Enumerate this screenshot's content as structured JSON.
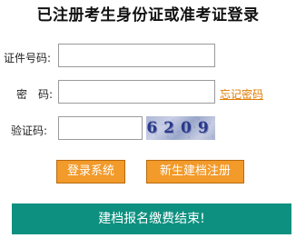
{
  "page": {
    "title": "已注册考生身份证或准考证登录"
  },
  "form": {
    "id_label": "证件号码:",
    "id_value": "",
    "password_label": "密　码:",
    "password_value": "",
    "forgot_link": "忘记密码",
    "captcha_label": "验证码:",
    "captcha_value": "",
    "captcha_code": "6209"
  },
  "buttons": {
    "login": "登录系统",
    "register": "新生建档注册"
  },
  "banner": {
    "text": "建档报名缴费结束!"
  },
  "colors": {
    "button_bg": "#f29a2a",
    "banner_bg": "#0e9080",
    "link": "#e07b00"
  }
}
